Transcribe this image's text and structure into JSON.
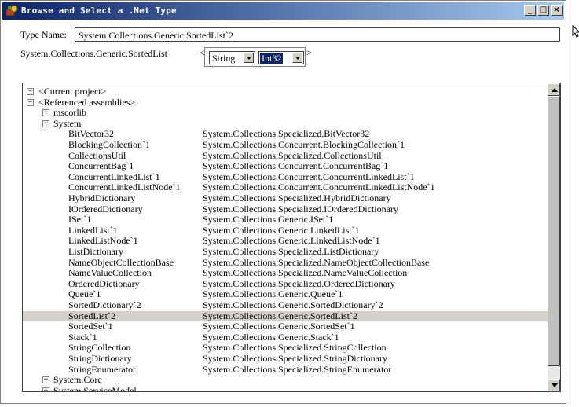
{
  "window": {
    "title": "Browse and Select a .Net Type"
  },
  "type_name": {
    "label": "Type Name:",
    "value": "System.Collections.Generic.SortedList`2"
  },
  "generic_args": {
    "base_name": "System.Collections.Generic.SortedList",
    "open": "<",
    "close": ">",
    "arg1": "String",
    "arg2": "Int32"
  },
  "tree": {
    "nodes": [
      {
        "text": "<Current project>",
        "indent": 0,
        "expander": "−"
      },
      {
        "text": "<Referenced assemblies>",
        "indent": 0,
        "expander": "−"
      },
      {
        "text": "mscorlib",
        "indent": 1,
        "expander": "+"
      },
      {
        "text": "System",
        "indent": 1,
        "expander": "−"
      },
      {
        "text": "BitVector32",
        "full": "System.Collections.Specialized.BitVector32",
        "indent": 2
      },
      {
        "text": "BlockingCollection`1",
        "full": "System.Collections.Concurrent.BlockingCollection`1",
        "indent": 2
      },
      {
        "text": "CollectionsUtil",
        "full": "System.Collections.Specialized.CollectionsUtil",
        "indent": 2
      },
      {
        "text": "ConcurrentBag`1",
        "full": "System.Collections.Concurrent.ConcurrentBag`1",
        "indent": 2
      },
      {
        "text": "ConcurrentLinkedList`1",
        "full": "System.Collections.Concurrent.ConcurrentLinkedList`1",
        "indent": 2
      },
      {
        "text": "ConcurrentLinkedListNode`1",
        "full": "System.Collections.Concurrent.ConcurrentLinkedListNode`1",
        "indent": 2
      },
      {
        "text": "HybridDictionary",
        "full": "System.Collections.Specialized.HybridDictionary",
        "indent": 2
      },
      {
        "text": "IOrderedDictionary",
        "full": "System.Collections.Specialized.IOrderedDictionary",
        "indent": 2
      },
      {
        "text": "ISet`1",
        "full": "System.Collections.Generic.ISet`1",
        "indent": 2
      },
      {
        "text": "LinkedList`1",
        "full": "System.Collections.Generic.LinkedList`1",
        "indent": 2
      },
      {
        "text": "LinkedListNode`1",
        "full": "System.Collections.Generic.LinkedListNode`1",
        "indent": 2
      },
      {
        "text": "ListDictionary",
        "full": "System.Collections.Specialized.ListDictionary",
        "indent": 2
      },
      {
        "text": "NameObjectCollectionBase",
        "full": "System.Collections.Specialized.NameObjectCollectionBase",
        "indent": 2
      },
      {
        "text": "NameValueCollection",
        "full": "System.Collections.Specialized.NameValueCollection",
        "indent": 2
      },
      {
        "text": "OrderedDictionary",
        "full": "System.Collections.Specialized.OrderedDictionary",
        "indent": 2
      },
      {
        "text": "Queue`1",
        "full": "System.Collections.Generic.Queue`1",
        "indent": 2
      },
      {
        "text": "SortedDictionary`2",
        "full": "System.Collections.Generic.SortedDictionary`2",
        "indent": 2
      },
      {
        "text": "SortedList`2",
        "full": "System.Collections.Generic.SortedList`2",
        "indent": 2,
        "selected": true
      },
      {
        "text": "SortedSet`1",
        "full": "System.Collections.Generic.SortedSet`1",
        "indent": 2
      },
      {
        "text": "Stack`1",
        "full": "System.Collections.Generic.Stack`1",
        "indent": 2
      },
      {
        "text": "StringCollection",
        "full": "System.Collections.Specialized.StringCollection",
        "indent": 2
      },
      {
        "text": "StringDictionary",
        "full": "System.Collections.Specialized.StringDictionary",
        "indent": 2
      },
      {
        "text": "StringEnumerator",
        "full": "System.Collections.Specialized.StringEnumerator",
        "indent": 2
      },
      {
        "text": "System.Core",
        "indent": 1,
        "expander": "+"
      },
      {
        "text": "System.ServiceModel",
        "indent": 1,
        "expander": "+"
      }
    ]
  },
  "colors": {
    "title_start": "#0a246a",
    "title_end": "#a6caf0",
    "selection_bg": "#d4d0c8"
  }
}
